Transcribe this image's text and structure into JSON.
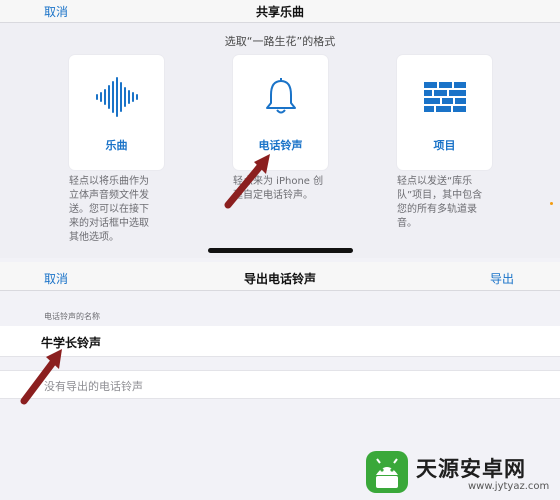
{
  "share_sheet": {
    "cancel_label": "取消",
    "title": "共享乐曲",
    "subtitle": "选取“一路生花”的格式",
    "options": [
      {
        "label": "乐曲",
        "icon": "waveform-icon",
        "description": "轻点以将乐曲作为\n立体声音频文件发\n送。您可以在接下\n来的对话框中选取\n其他选项。"
      },
      {
        "label": "电话铃声",
        "icon": "bell-icon",
        "description": "轻点来为 iPhone 创\n建自定电话铃声。"
      },
      {
        "label": "项目",
        "icon": "project-icon",
        "description": "轻点以发送“库乐\n队”项目，其中包含\n您的所有多轨道录\n音。"
      }
    ]
  },
  "export_sheet": {
    "cancel_label": "取消",
    "title": "导出电话铃声",
    "export_label": "导出",
    "field_caption": "电话铃声的名称",
    "ringtone_name": "牛学长铃声",
    "empty_list_text": "没有导出的电话铃声"
  },
  "watermark": {
    "title": "天源安卓网",
    "url": "www.jytyaz.com"
  },
  "colors": {
    "accent": "#1a73c8",
    "annotation_arrow": "#8b1f1f",
    "watermark_green": "#3aa83a"
  }
}
